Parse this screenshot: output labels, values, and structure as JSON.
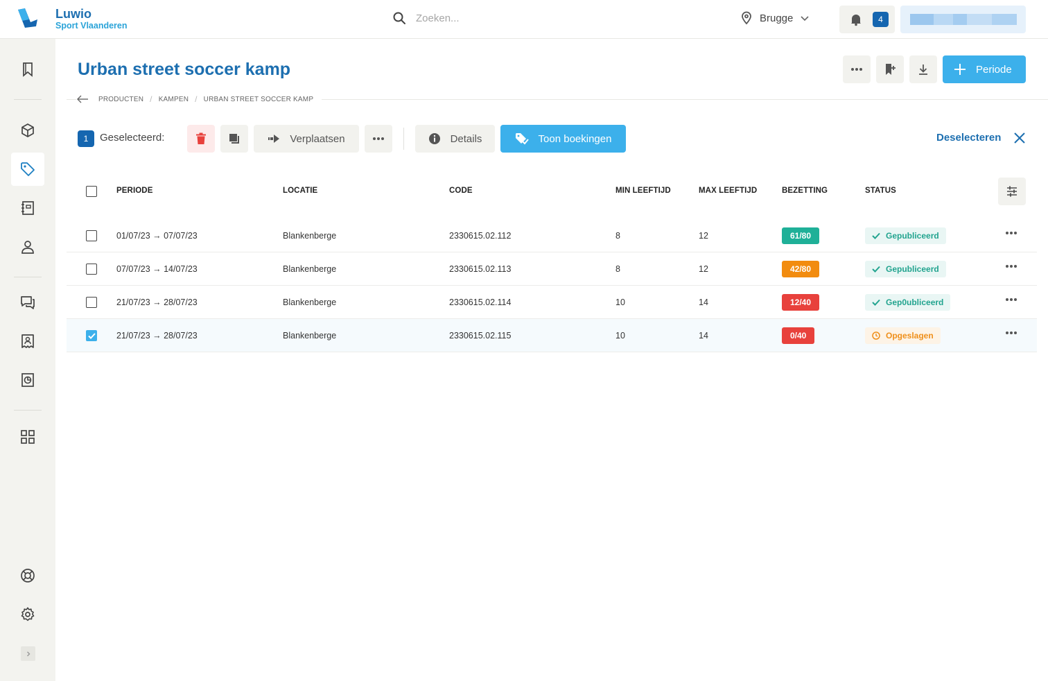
{
  "brand": {
    "name": "Luwio",
    "sub": "Sport Vlaanderen",
    "color": "#1d6fb0"
  },
  "search": {
    "placeholder": "Zoeken..."
  },
  "location": {
    "label": "Brugge"
  },
  "notifications": {
    "count": "4"
  },
  "page": {
    "title": "Urban street soccer kamp"
  },
  "header_actions": {
    "add_label": "Periode"
  },
  "breadcrumb": [
    "PRODUCTEN",
    "KAMPEN",
    "URBAN STREET SOCCER KAMP"
  ],
  "selection": {
    "count": "1",
    "label": "Geselecteerd:",
    "move_label": "Verplaatsen",
    "details_label": "Details",
    "bookings_label": "Toon boekingen",
    "deselect_label": "Deselecteren"
  },
  "table": {
    "headers": {
      "period": "PERIODE",
      "location": "LOCATIE",
      "code": "CODE",
      "min_age": "MIN LEEFTIJD",
      "max_age": "MAX LEEFTIJD",
      "occupancy": "BEZETTING",
      "status": "STATUS"
    },
    "rows": [
      {
        "period": "01/07/23 → 07/07/23",
        "location": "Blankenberge",
        "code": "2330615.02.112",
        "min_age": "8",
        "max_age": "12",
        "occupancy": "61/80",
        "occupancy_color": "#1fb098",
        "status": "Gepubliceerd",
        "status_type": "published",
        "checked": false
      },
      {
        "period": "07/07/23 → 14/07/23",
        "location": "Blankenberge",
        "code": "2330615.02.113",
        "min_age": "8",
        "max_age": "12",
        "occupancy": "42/80",
        "occupancy_color": "#f28c0f",
        "status": "Gepubliceerd",
        "status_type": "published",
        "checked": false
      },
      {
        "period": "21/07/23 → 28/07/23",
        "location": "Blankenberge",
        "code": "2330615.02.114",
        "min_age": "10",
        "max_age": "14",
        "occupancy": "12/40",
        "occupancy_color": "#e8413c",
        "status": "Gep0ubliceerd",
        "status_type": "published",
        "checked": false
      },
      {
        "period": "21/07/23 → 28/07/23",
        "location": "Blankenberge",
        "code": "2330615.02.115",
        "min_age": "10",
        "max_age": "14",
        "occupancy": "0/40",
        "occupancy_color": "#e8413c",
        "status": "Opgeslagen",
        "status_type": "saved",
        "checked": true
      }
    ]
  },
  "colors": {
    "accent": "#3cb0eb",
    "primary_dark": "#1566b0",
    "danger": "#e8413c",
    "success": "#22a48f",
    "warning": "#ef8f1a"
  },
  "icons": {
    "sidebar": [
      "bookmark-icon",
      "box-icon",
      "tag-icon",
      "notebook-icon",
      "user-icon",
      "chat-icon",
      "receipt-icon",
      "report-icon",
      "apps-icon",
      "lifebuoy-icon",
      "gear-icon",
      "chevron-right-icon"
    ]
  }
}
